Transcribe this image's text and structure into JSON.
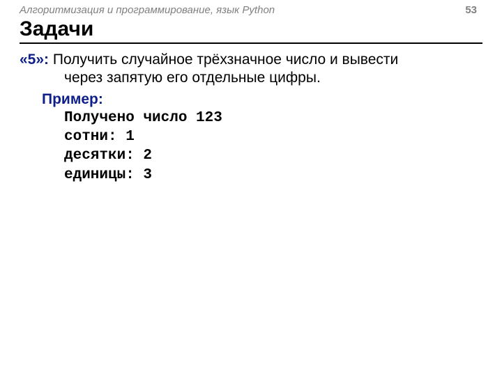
{
  "header": {
    "subject": "Алгоритмизация и программирование, язык Python",
    "page": "53"
  },
  "title": "Задачи",
  "task": {
    "label": "«5»:",
    "text_line1": " Получить случайное трёхзначное число и вывести",
    "text_line2": "через запятую его отдельные цифры."
  },
  "example": {
    "label": "Пример:",
    "line1": "Получено число 123",
    "line2": "сотни: 1",
    "line3": "десятки: 2",
    "line4": "единицы: 3"
  }
}
